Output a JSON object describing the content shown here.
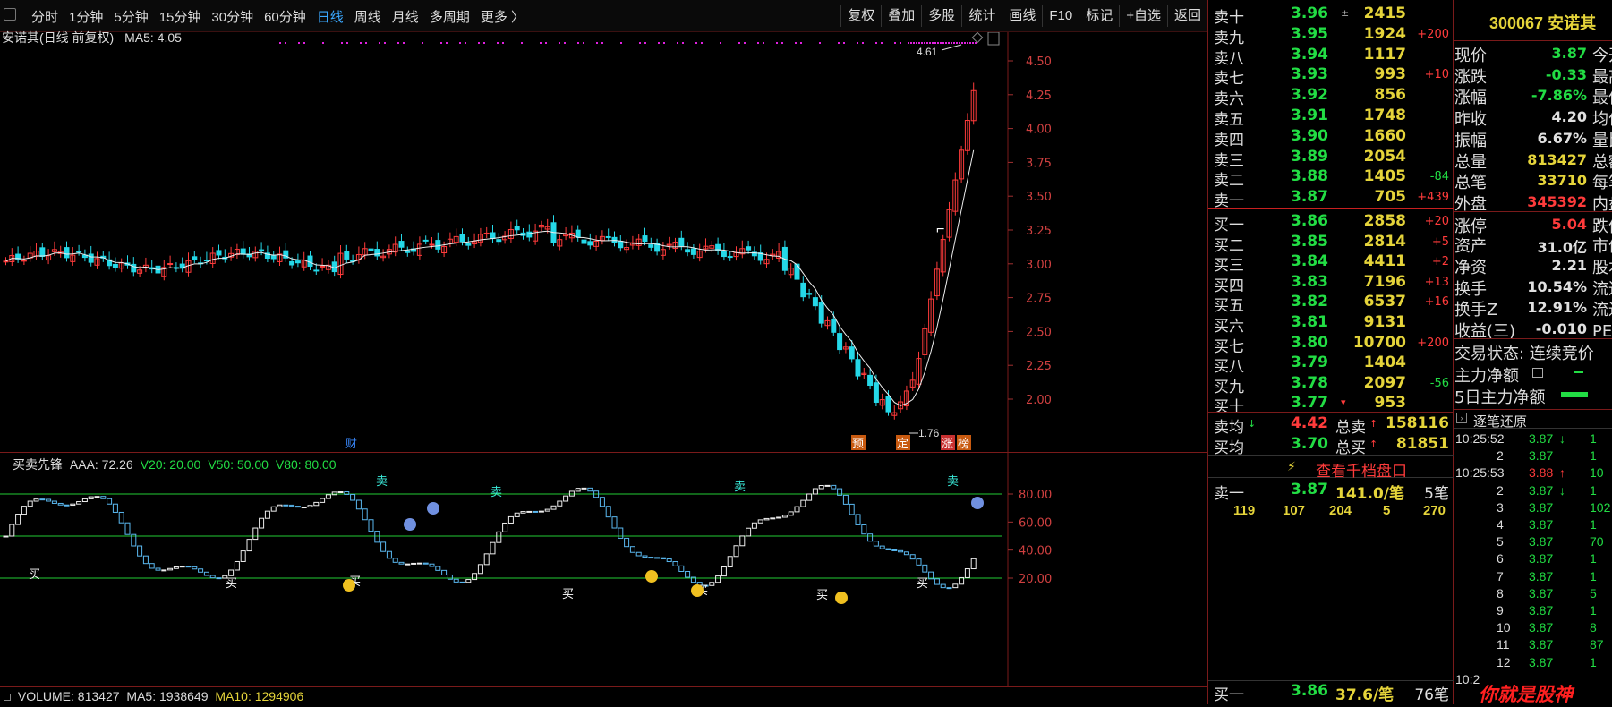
{
  "toolbar": {
    "periods": [
      "分时",
      "1分钟",
      "5分钟",
      "15分钟",
      "30分钟",
      "60分钟",
      "日线",
      "周线",
      "月线",
      "多周期",
      "更多 〉"
    ],
    "active_period": "日线",
    "tools": [
      "复权",
      "叠加",
      "多股",
      "统计",
      "画线",
      "F10",
      "标记",
      "+自选",
      "返回"
    ]
  },
  "chart_header": {
    "title": "安诺其(日线 前复权)",
    "ma_label": "MA5: 4.05"
  },
  "price_axis": [
    "4.50",
    "4.25",
    "4.00",
    "3.75",
    "3.50",
    "3.25",
    "3.00",
    "2.75",
    "2.50",
    "2.25",
    "2.00"
  ],
  "annotations": {
    "high_label": "4.61",
    "low_label": "1.76",
    "event_badges": [
      {
        "text": "财",
        "color": "#2a6bd6"
      },
      {
        "text": "预",
        "color": "#c85a10"
      },
      {
        "text": "定",
        "color": "#c85a10"
      },
      {
        "text": "涨",
        "color": "#c83030"
      },
      {
        "text": "榜",
        "color": "#c85a10"
      }
    ]
  },
  "oscillator": {
    "name": "买卖先锋",
    "aaa": "AAA: 72.26",
    "v20": "V20: 20.00",
    "v50": "V50: 50.00",
    "v80": "V80: 80.00",
    "axis": [
      "80.00",
      "60.00",
      "40.00",
      "20.00"
    ],
    "sell_label": "卖",
    "buy_label": "买"
  },
  "volume_bar": {
    "volume": "VOLUME: 813427",
    "ma5": "MA5: 1938649",
    "ma10": "MA10: 1294906"
  },
  "orderbook": {
    "asks": [
      {
        "name": "卖十",
        "price": "3.96",
        "vol": "2415",
        "chg": "",
        "mark": "±"
      },
      {
        "name": "卖九",
        "price": "3.95",
        "vol": "1924",
        "chg": "+200"
      },
      {
        "name": "卖八",
        "price": "3.94",
        "vol": "1117",
        "chg": ""
      },
      {
        "name": "卖七",
        "price": "3.93",
        "vol": "993",
        "chg": "+10"
      },
      {
        "name": "卖六",
        "price": "3.92",
        "vol": "856",
        "chg": ""
      },
      {
        "name": "卖五",
        "price": "3.91",
        "vol": "1748",
        "chg": ""
      },
      {
        "name": "卖四",
        "price": "3.90",
        "vol": "1660",
        "chg": ""
      },
      {
        "name": "卖三",
        "price": "3.89",
        "vol": "2054",
        "chg": ""
      },
      {
        "name": "卖二",
        "price": "3.88",
        "vol": "1405",
        "chg": "-84"
      },
      {
        "name": "卖一",
        "price": "3.87",
        "vol": "705",
        "chg": "+439"
      }
    ],
    "bids": [
      {
        "name": "买一",
        "price": "3.86",
        "vol": "2858",
        "chg": "+20"
      },
      {
        "name": "买二",
        "price": "3.85",
        "vol": "2814",
        "chg": "+5"
      },
      {
        "name": "买三",
        "price": "3.84",
        "vol": "4411",
        "chg": "+2"
      },
      {
        "name": "买四",
        "price": "3.83",
        "vol": "7196",
        "chg": "+13"
      },
      {
        "name": "买五",
        "price": "3.82",
        "vol": "6537",
        "chg": "+16"
      },
      {
        "name": "买六",
        "price": "3.81",
        "vol": "9131",
        "chg": ""
      },
      {
        "name": "买七",
        "price": "3.80",
        "vol": "10700",
        "chg": "+200"
      },
      {
        "name": "买八",
        "price": "3.79",
        "vol": "1404",
        "chg": ""
      },
      {
        "name": "买九",
        "price": "3.78",
        "vol": "2097",
        "chg": "-56"
      },
      {
        "name": "买十",
        "price": "3.77",
        "vol": "953",
        "chg": "",
        "mark": "▾"
      }
    ],
    "ask_avg_label": "卖均",
    "ask_avg": "4.42",
    "total_sell_label": "总卖",
    "total_sell": "158116",
    "bid_avg_label": "买均",
    "bid_avg": "3.70",
    "total_buy_label": "总买",
    "total_buy": "81851",
    "depth_button": "查看千档盘口",
    "sell1_row": {
      "name": "卖一",
      "price": "3.87",
      "per": "141.0/笔",
      "count": "5笔"
    },
    "sell1_queue": [
      "119",
      "107",
      "204",
      "5",
      "270"
    ],
    "buy1_row": {
      "name": "买一",
      "price": "3.86",
      "per": "37.6/笔",
      "count": "76笔"
    }
  },
  "quote": {
    "code_name": "300067 安诺其",
    "rows": [
      {
        "name": "现价",
        "val": "3.87",
        "color": "green",
        "next": "今开"
      },
      {
        "name": "涨跌",
        "val": "-0.33",
        "color": "green",
        "next": "最高"
      },
      {
        "name": "涨幅",
        "val": "-7.86%",
        "color": "green",
        "next": "最低"
      },
      {
        "name": "昨收",
        "val": "4.20",
        "color": "white",
        "next": "均价"
      },
      {
        "name": "振幅",
        "val": "6.67%",
        "color": "white",
        "next": "量比"
      },
      {
        "name": "总量",
        "val": "813427",
        "color": "yellow",
        "next": "总额"
      },
      {
        "name": "总笔",
        "val": "33710",
        "color": "yellow",
        "next": "每笔"
      },
      {
        "name": "外盘",
        "val": "345392",
        "color": "red",
        "next": "内盘"
      },
      {
        "name": "涨停",
        "val": "5.04",
        "color": "red",
        "next": "跌停"
      },
      {
        "name": "资产",
        "val": "31.0亿",
        "color": "white",
        "next": "市值"
      },
      {
        "name": "净资",
        "val": "2.21",
        "color": "white",
        "next": "股本"
      },
      {
        "name": "换手",
        "val": "10.54%",
        "color": "white",
        "next": "流通"
      },
      {
        "name": "换手Z",
        "val": "12.91%",
        "color": "white",
        "next": "流通"
      },
      {
        "name": "收益(三)",
        "val": "-0.010",
        "color": "white",
        "next": "PE(动)"
      }
    ],
    "trade_status": "交易状态: 连续竞价",
    "main_net": "主力净额",
    "main_net_5d": "5日主力净额",
    "ticks_header": "逐笔还原",
    "ticks": [
      {
        "time": "10:25:52",
        "price": "3.87",
        "dir": "down",
        "vol": "1"
      },
      {
        "time": "2",
        "price": "3.87",
        "dir": "",
        "vol": "1"
      },
      {
        "time": "10:25:53",
        "price": "3.88",
        "dir": "up",
        "vol": "10"
      },
      {
        "time": "2",
        "price": "3.87",
        "dir": "down",
        "vol": "1"
      },
      {
        "time": "3",
        "price": "3.87",
        "dir": "",
        "vol": "102"
      },
      {
        "time": "4",
        "price": "3.87",
        "dir": "",
        "vol": "1"
      },
      {
        "time": "5",
        "price": "3.87",
        "dir": "",
        "vol": "70"
      },
      {
        "time": "6",
        "price": "3.87",
        "dir": "",
        "vol": "1"
      },
      {
        "time": "7",
        "price": "3.87",
        "dir": "",
        "vol": "1"
      },
      {
        "time": "8",
        "price": "3.87",
        "dir": "",
        "vol": "5"
      },
      {
        "time": "9",
        "price": "3.87",
        "dir": "",
        "vol": "1"
      },
      {
        "time": "10",
        "price": "3.87",
        "dir": "",
        "vol": "8"
      },
      {
        "time": "11",
        "price": "3.87",
        "dir": "",
        "vol": "87"
      },
      {
        "time": "12",
        "price": "3.87",
        "dir": "",
        "vol": "1"
      },
      {
        "time": "10:2",
        "price": "",
        "dir": "",
        "vol": ""
      }
    ]
  },
  "watermark": "你就是股神"
}
